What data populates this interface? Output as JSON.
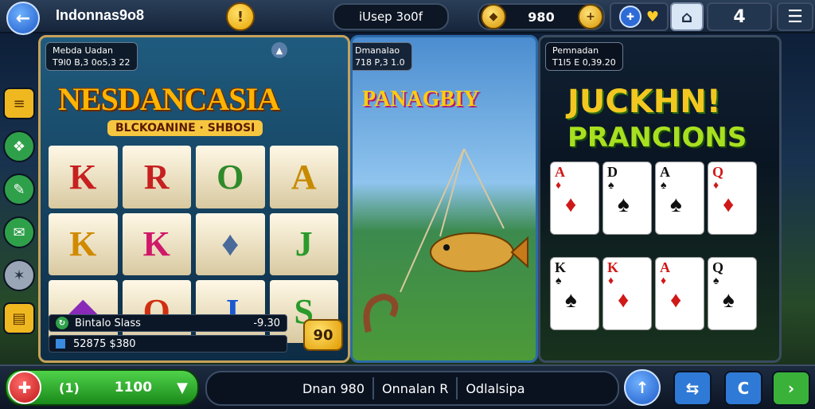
{
  "app": {
    "title": "Indonnas9o8"
  },
  "header": {
    "back_icon": "back-arrow-icon",
    "alert_icon": "exclamation-icon",
    "alert_glyph": "!",
    "user_label": "iUsep 3o0f",
    "balance": "980",
    "add_glyph": "+",
    "mode_value": "4"
  },
  "games": [
    {
      "name": "Nesdancasia",
      "logo_text": "NESDANCASIA",
      "subtitle": "BLCKOANINE · SHBOSI",
      "tag_line1": "Mebda Uadan",
      "tag_line2": "T9l0 B,3 0o5,3 22",
      "reels": [
        "K",
        "R",
        "O",
        "A",
        "K",
        "K",
        "♦",
        "J",
        "◆",
        "O",
        "J",
        "S"
      ],
      "win_label": "Bintalo Slass",
      "win_value": "-9.30",
      "credit": "52875 $380",
      "spin_value": "90"
    },
    {
      "name": "Panagbiy",
      "logo_text": "PANAGBIY",
      "tag_line1": "Dmanalao",
      "tag_line2": "718 P,3 1.0"
    },
    {
      "name": "Juckhn Prancions",
      "logo_line1": "JUCKHN!",
      "logo_line2": "PRANCIONS",
      "tag_line1": "Pemnadan",
      "tag_line2": "T1l5 E 0,39.20",
      "cards_top": [
        {
          "rank": "A",
          "suit": "♦",
          "red": true
        },
        {
          "rank": "D",
          "suit": "♠",
          "red": false
        },
        {
          "rank": "A",
          "suit": "♠",
          "red": false
        },
        {
          "rank": "Q",
          "suit": "♦",
          "red": true
        }
      ],
      "cards_bottom": [
        {
          "rank": "K",
          "suit": "♠",
          "red": false
        },
        {
          "rank": "K",
          "suit": "♦",
          "red": true
        },
        {
          "rank": "A",
          "suit": "♦",
          "red": true
        },
        {
          "rank": "Q",
          "suit": "♠",
          "red": false
        }
      ]
    }
  ],
  "footer": {
    "bet_label": "(1)",
    "bet_amount": "1100",
    "info_items": [
      "Dnan 980",
      "Onnalan R",
      "Odlalsipa"
    ]
  },
  "colors": {
    "accent_gold": "#c7a15a",
    "bet_green": "#2ba82a",
    "bg": "#0e1a2e"
  }
}
